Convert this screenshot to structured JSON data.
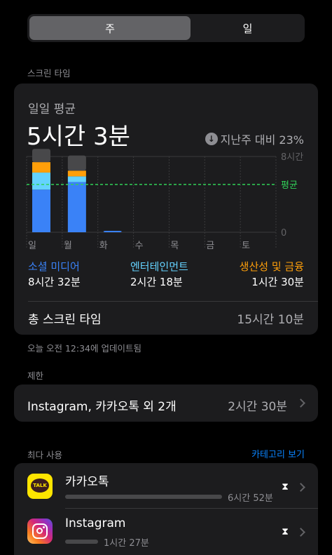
{
  "segment": {
    "week": "주",
    "day": "일"
  },
  "screen_time_header": "스크린 타임",
  "card": {
    "avg_label": "일일 평균",
    "avg_time": "5시간 3분",
    "compare": "지난주 대비 23%",
    "categories": [
      {
        "label": "소셜 미디어",
        "value": "8시간 32분",
        "color": "#3a82f7"
      },
      {
        "label": "엔터테인먼트",
        "value": "2시간 18분",
        "color": "#64d2ff"
      },
      {
        "label": "생산성 및 금융",
        "value": "1시간 30분",
        "color": "#ff9f0a"
      }
    ],
    "total_label": "총 스크린 타임",
    "total_value": "15시간 10분"
  },
  "chart_data": {
    "type": "bar",
    "categories": [
      "일",
      "월",
      "화",
      "수",
      "목",
      "금",
      "토"
    ],
    "series": [
      {
        "name": "소셜 미디어",
        "color": "#3a82f7",
        "values": [
          4.5,
          5.3,
          0.15,
          0,
          0,
          0,
          0
        ]
      },
      {
        "name": "엔터테인먼트",
        "color": "#64d2ff",
        "values": [
          1.8,
          0.6,
          0,
          0,
          0,
          0,
          0
        ]
      },
      {
        "name": "생산성 및 금융",
        "color": "#ff9f0a",
        "values": [
          1.1,
          0.6,
          0,
          0,
          0,
          0,
          0
        ]
      },
      {
        "name": "",
        "color": "#48484a",
        "values": [
          1.4,
          1.6,
          0,
          0,
          0,
          0,
          0
        ]
      }
    ],
    "ylim": [
      0,
      8
    ],
    "yticks": [
      "0",
      "8시간"
    ],
    "average_value": 5.05,
    "average_label": "평균",
    "average_color": "#30d158",
    "grid": true
  },
  "updated": "오늘 오전 12:34에 업데이트됨",
  "limits": {
    "header": "제한",
    "title": "Instagram, 카카오톡 외 2개",
    "value": "2시간 30분"
  },
  "most_used": {
    "header": "최다 사용",
    "category_link": "카테고리 보기",
    "apps": [
      {
        "name": "카카오톡",
        "usage": "6시간 52분",
        "fraction": 1.0,
        "icon_text": "TALK"
      },
      {
        "name": "Instagram",
        "usage": "1시간 27분",
        "fraction": 0.21
      }
    ]
  }
}
